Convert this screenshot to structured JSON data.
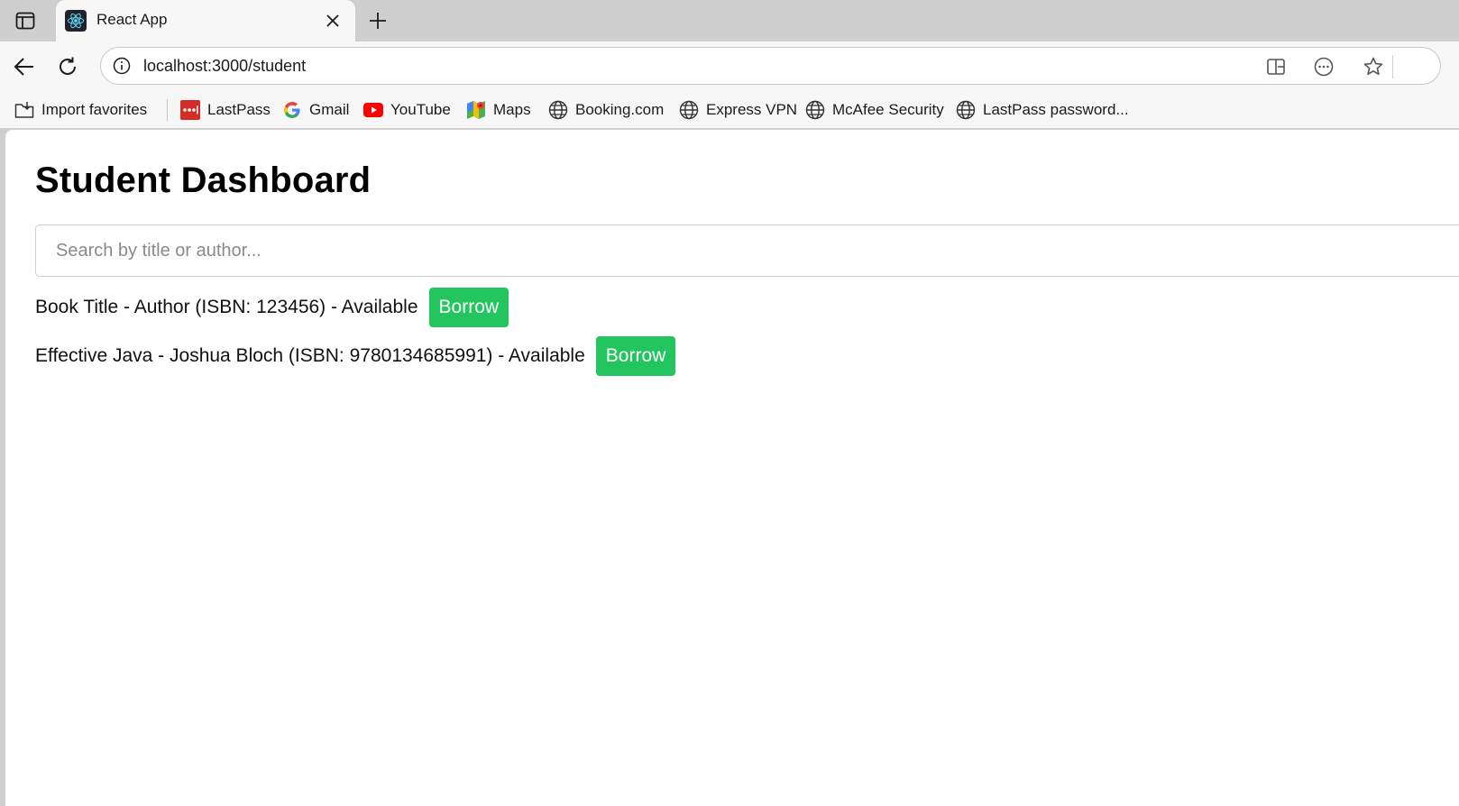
{
  "browser": {
    "tab": {
      "title": "React App"
    },
    "address": {
      "host": "localhost",
      "path": ":3000/student"
    },
    "bookmarks": [
      {
        "label": "Import favorites",
        "icon": "import-favorites-icon"
      },
      {
        "label": "LastPass",
        "icon": "lastpass-icon"
      },
      {
        "label": "Gmail",
        "icon": "google-icon"
      },
      {
        "label": "YouTube",
        "icon": "youtube-icon"
      },
      {
        "label": "Maps",
        "icon": "maps-icon"
      },
      {
        "label": "Booking.com",
        "icon": "globe-icon"
      },
      {
        "label": "Express VPN",
        "icon": "globe-icon"
      },
      {
        "label": "McAfee Security",
        "icon": "globe-icon"
      },
      {
        "label": "LastPass password...",
        "icon": "globe-icon"
      }
    ]
  },
  "dashboard": {
    "title": "Student Dashboard",
    "search_placeholder": "Search by title or author...",
    "books": [
      {
        "text": "Book Title - Author (ISBN: 123456) - Available",
        "action": "Borrow"
      },
      {
        "text": "Effective Java - Joshua Bloch (ISBN: 9780134685991) - Available",
        "action": "Borrow"
      }
    ]
  },
  "colors": {
    "borrow_button": "#22c55e",
    "chrome_background": "#cfcfcf",
    "toolbar_background": "#f7f7f7",
    "lastpass_red": "#d32d27",
    "youtube_red": "#ff0000"
  }
}
